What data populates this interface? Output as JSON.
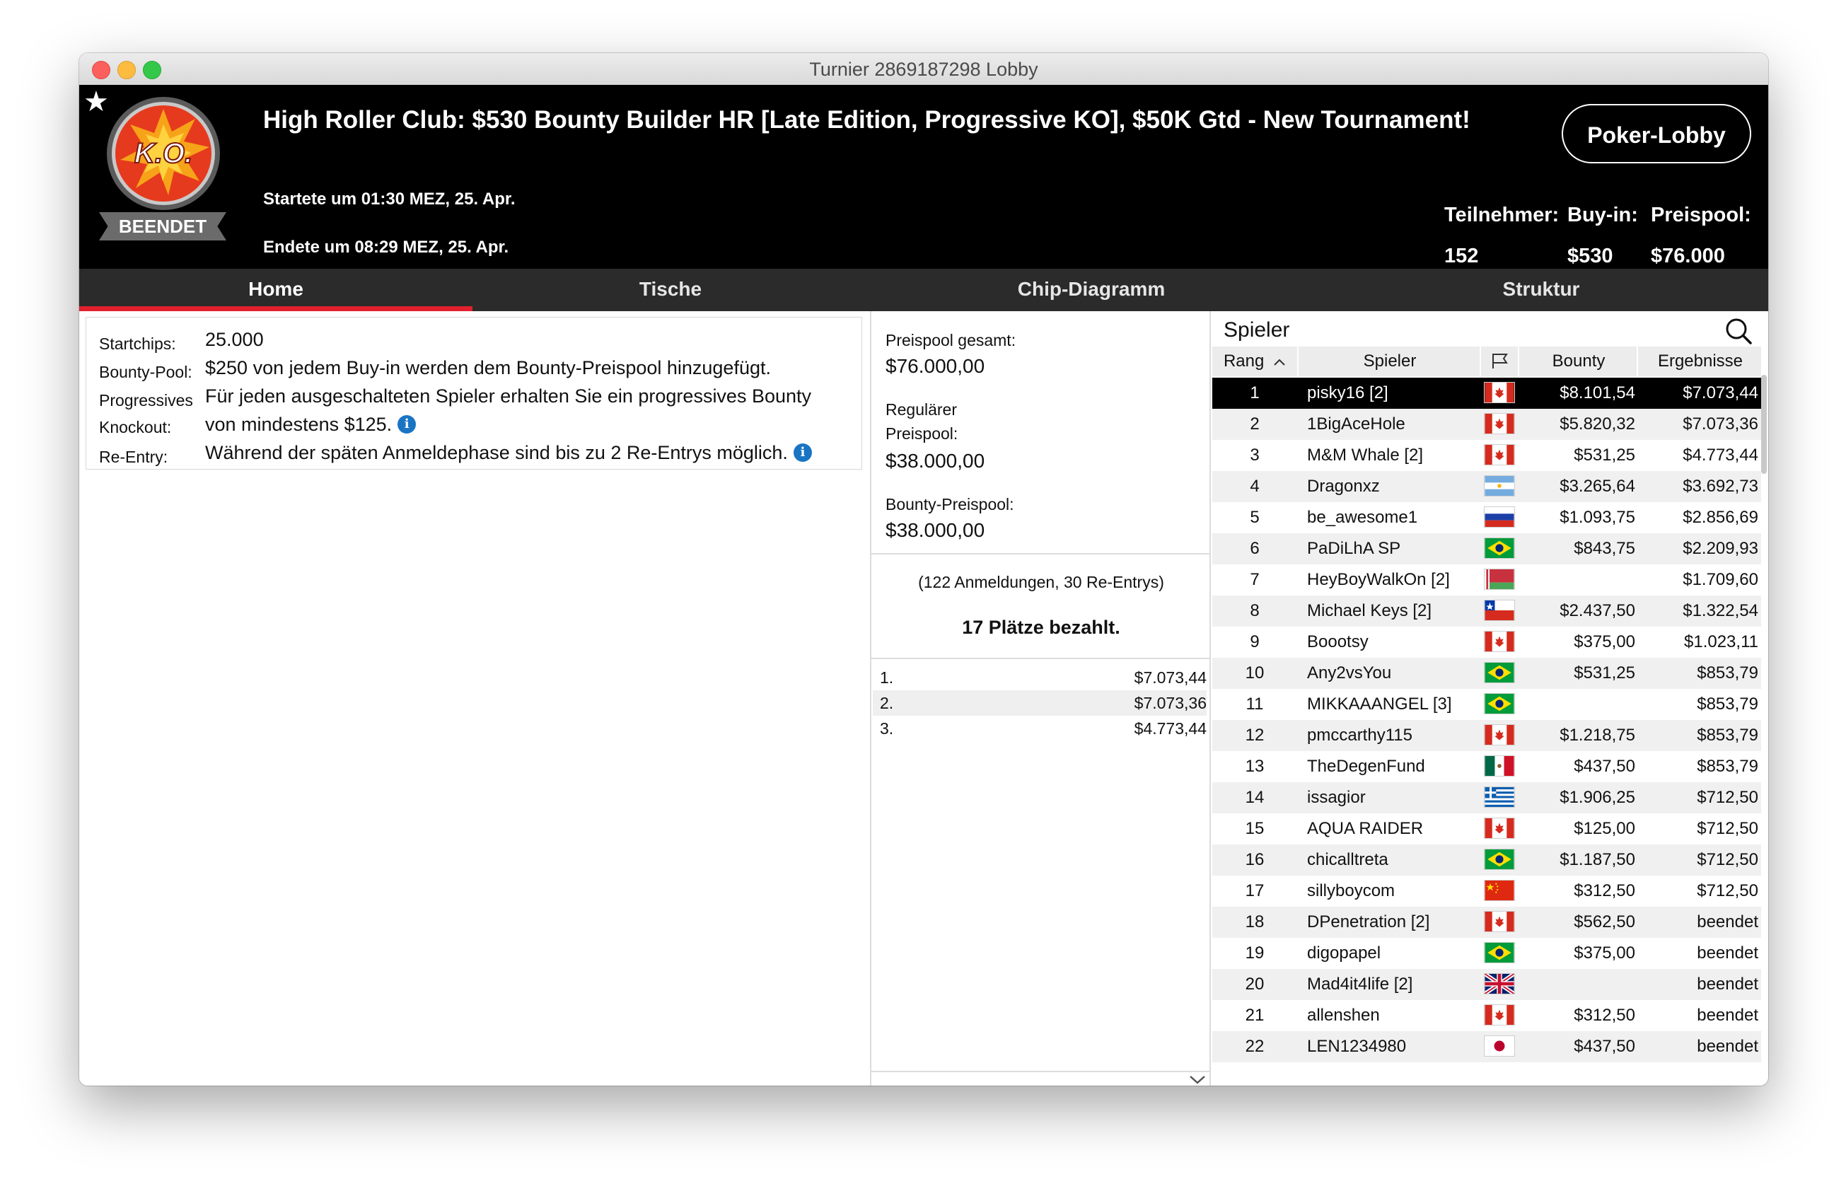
{
  "window": {
    "title": "Turnier 2869187298 Lobby"
  },
  "header": {
    "logo_text": "K.O.",
    "status": "BEENDET",
    "tournament_title": "High Roller Club: $530 Bounty Builder HR [Late Edition, Progressive KO], $50K Gtd - New Tournament!",
    "started": "Startete um 01:30 MEZ, 25. Apr.",
    "ended": "Endete um 08:29 MEZ, 25. Apr.",
    "lobby_button": "Poker-Lobby",
    "stats": {
      "participants_label": "Teilnehmer:",
      "participants_value": "152",
      "buyin_label": "Buy-in:",
      "buyin_value": "$530",
      "prizepool_label": "Preispool:",
      "prizepool_value": "$76.000"
    }
  },
  "tabs": [
    "Home",
    "Tische",
    "Chip-Diagramm",
    "Struktur"
  ],
  "info": {
    "startchips_label": "Startchips:",
    "startchips_value": "25.000",
    "bountypool_label": "Bounty-Pool:",
    "bountypool_value": "$250 von jedem Buy-in werden dem Bounty-Preispool hinzugefügt.",
    "progressive_label": "Progressives",
    "knockout_label": "Knockout:",
    "progressive_value_1": "Für jeden ausgeschalteten Spieler erhalten Sie ein progressives Bounty",
    "progressive_value_2": "von mindestens $125.",
    "reentry_label": "Re-Entry:",
    "reentry_value": "Während der späten Anmeldephase sind bis zu 2 Re-Entrys möglich.",
    "info_icon": "i"
  },
  "prizepool": {
    "total_label": "Preispool gesamt:",
    "total_value": "$76.000,00",
    "regular_label_1": "Regulärer",
    "regular_label_2": "Preispool:",
    "regular_value": "$38.000,00",
    "bounty_label": "Bounty-Preispool:",
    "bounty_value": "$38.000,00",
    "registrations": "(122 Anmeldungen, 30 Re-Entrys)",
    "places_paid": "17 Plätze bezahlt.",
    "payouts": [
      {
        "pos": "1.",
        "amount": "$7.073,44"
      },
      {
        "pos": "2.",
        "amount": "$7.073,36"
      },
      {
        "pos": "3.",
        "amount": "$4.773,44"
      }
    ]
  },
  "players": {
    "title": "Spieler",
    "columns": {
      "rank": "Rang",
      "player": "Spieler",
      "bounty": "Bounty",
      "results": "Ergebnisse"
    },
    "rows": [
      {
        "rank": "1",
        "name": "pisky16 [2]",
        "flag": "ca",
        "bounty": "$8.101,54",
        "result": "$7.073,44"
      },
      {
        "rank": "2",
        "name": "1BigAceHole",
        "flag": "ca",
        "bounty": "$5.820,32",
        "result": "$7.073,36"
      },
      {
        "rank": "3",
        "name": "M&M Whale [2]",
        "flag": "ca",
        "bounty": "$531,25",
        "result": "$4.773,44"
      },
      {
        "rank": "4",
        "name": "Dragonxz",
        "flag": "ar",
        "bounty": "$3.265,64",
        "result": "$3.692,73"
      },
      {
        "rank": "5",
        "name": "be_awesome1",
        "flag": "ru",
        "bounty": "$1.093,75",
        "result": "$2.856,69"
      },
      {
        "rank": "6",
        "name": "PaDiLhA SP",
        "flag": "br",
        "bounty": "$843,75",
        "result": "$2.209,93"
      },
      {
        "rank": "7",
        "name": "HeyBoyWalkOn [2]",
        "flag": "by",
        "bounty": "",
        "result": "$1.709,60"
      },
      {
        "rank": "8",
        "name": "Michael Keys [2]",
        "flag": "cl",
        "bounty": "$2.437,50",
        "result": "$1.322,54"
      },
      {
        "rank": "9",
        "name": "Boootsy",
        "flag": "ca",
        "bounty": "$375,00",
        "result": "$1.023,11"
      },
      {
        "rank": "10",
        "name": "Any2vsYou",
        "flag": "br",
        "bounty": "$531,25",
        "result": "$853,79"
      },
      {
        "rank": "11",
        "name": "MIKKAAANGEL [3]",
        "flag": "br",
        "bounty": "",
        "result": "$853,79"
      },
      {
        "rank": "12",
        "name": "pmccarthy115",
        "flag": "ca",
        "bounty": "$1.218,75",
        "result": "$853,79"
      },
      {
        "rank": "13",
        "name": "TheDegenFund",
        "flag": "mx",
        "bounty": "$437,50",
        "result": "$853,79"
      },
      {
        "rank": "14",
        "name": "issagior",
        "flag": "gr",
        "bounty": "$1.906,25",
        "result": "$712,50"
      },
      {
        "rank": "15",
        "name": "AQUA RAIDER",
        "flag": "ca",
        "bounty": "$125,00",
        "result": "$712,50"
      },
      {
        "rank": "16",
        "name": "chicalltreta",
        "flag": "br",
        "bounty": "$1.187,50",
        "result": "$712,50"
      },
      {
        "rank": "17",
        "name": "sillyboycom",
        "flag": "cn",
        "bounty": "$312,50",
        "result": "$712,50"
      },
      {
        "rank": "18",
        "name": "DPenetration [2]",
        "flag": "ca",
        "bounty": "$562,50",
        "result": "beendet"
      },
      {
        "rank": "19",
        "name": "digopapel",
        "flag": "br",
        "bounty": "$375,00",
        "result": "beendet"
      },
      {
        "rank": "20",
        "name": "Mad4it4life [2]",
        "flag": "gb",
        "bounty": "",
        "result": "beendet"
      },
      {
        "rank": "21",
        "name": "allenshen",
        "flag": "ca",
        "bounty": "$312,50",
        "result": "beendet"
      },
      {
        "rank": "22",
        "name": "LEN1234980",
        "flag": "jp",
        "bounty": "$437,50",
        "result": "beendet"
      }
    ]
  },
  "colors": {
    "accent_red": "#e0202c",
    "header_bg": "#000000",
    "tabbar_bg": "#2b2b2b"
  }
}
